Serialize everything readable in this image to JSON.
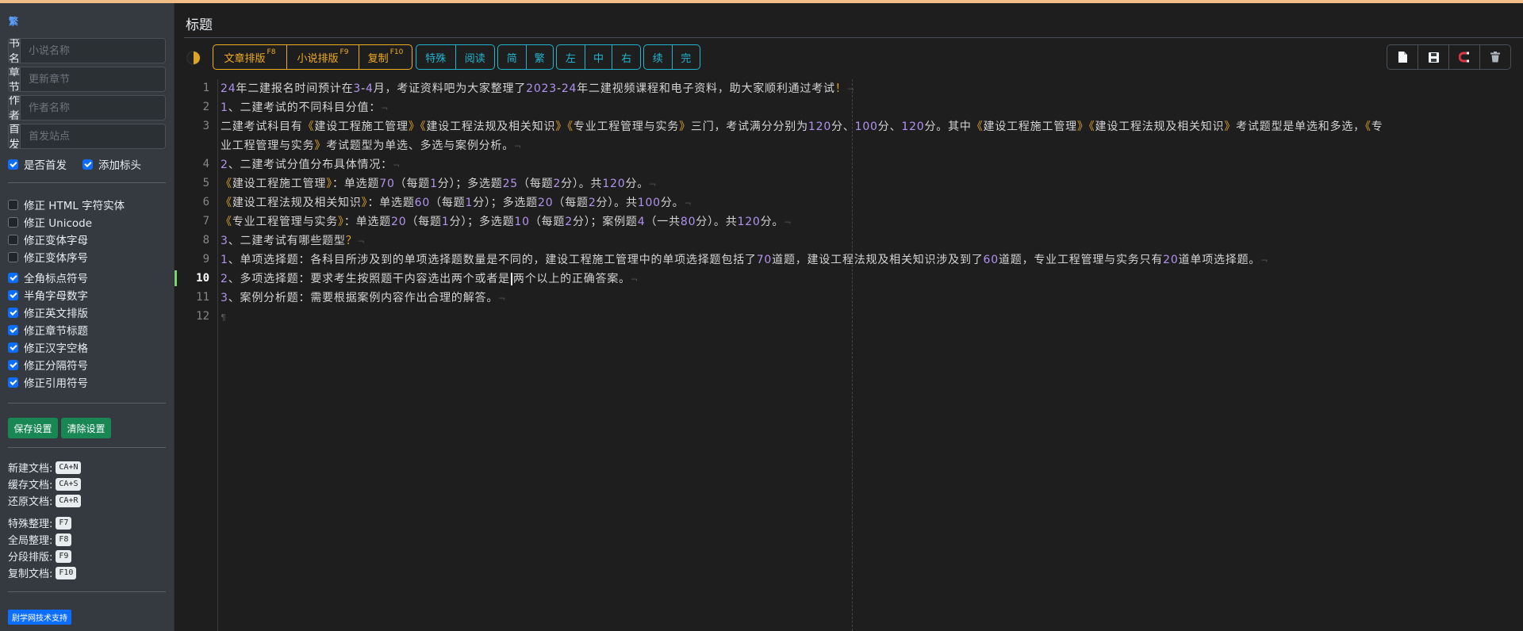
{
  "sidebar": {
    "logo": "繁",
    "fields": [
      {
        "label": "书名",
        "placeholder": "小说名称"
      },
      {
        "label": "章节",
        "placeholder": "更新章节"
      },
      {
        "label": "作者",
        "placeholder": "作者名称"
      },
      {
        "label": "首发",
        "placeholder": "首发站点"
      }
    ],
    "is_first": {
      "label": "是否首发",
      "checked": true
    },
    "add_header": {
      "label": "添加标头",
      "checked": true
    },
    "fix_options": [
      {
        "label": "修正 HTML 字符实体",
        "checked": false
      },
      {
        "label": "修正 Unicode",
        "checked": false
      },
      {
        "label": "修正变体字母",
        "checked": false
      },
      {
        "label": "修正变体序号",
        "checked": false
      },
      {
        "label": "全角标点符号",
        "checked": true
      },
      {
        "label": "半角字母数字",
        "checked": true
      },
      {
        "label": "修正英文排版",
        "checked": true
      },
      {
        "label": "修正章节标题",
        "checked": true
      },
      {
        "label": "修正汉字空格",
        "checked": true
      },
      {
        "label": "修正分隔符号",
        "checked": true
      },
      {
        "label": "修正引用符号",
        "checked": true
      }
    ],
    "save_label": "保存设置",
    "clear_label": "清除设置",
    "shortcuts_doc": [
      {
        "label": "新建文档:",
        "key": "CA+N"
      },
      {
        "label": "缓存文档:",
        "key": "CA+S"
      },
      {
        "label": "还原文档:",
        "key": "CA+R"
      }
    ],
    "shortcuts_fmt": [
      {
        "label": "特殊整理:",
        "key": "F7"
      },
      {
        "label": "全局整理:",
        "key": "F8"
      },
      {
        "label": "分段排版:",
        "key": "F9"
      },
      {
        "label": "复制文档:",
        "key": "F10"
      }
    ],
    "support": "尉学网技术支持"
  },
  "main": {
    "title": "标题",
    "toolbar": {
      "article_layout": "文章排版",
      "article_key": "F8",
      "novel_layout": "小说排版",
      "novel_key": "F9",
      "copy": "复制",
      "copy_key": "F10",
      "special": "特殊",
      "read": "阅读",
      "simplified": "简",
      "traditional": "繁",
      "left": "左",
      "center": "中",
      "right": "右",
      "continue": "续",
      "finish": "完"
    },
    "icons": [
      "new-file-icon",
      "save-icon",
      "magnet-icon",
      "trash-icon"
    ],
    "colors": {
      "accent_amber": "#f0ad1e",
      "accent_teal": "#1fb5cf",
      "number": "#b392f0",
      "quote": "#e0a526",
      "current_line": "#7fd36b"
    }
  },
  "editor": {
    "active_line": 10,
    "line_numbers": [
      "1",
      "2",
      "3",
      "4",
      "5",
      "6",
      "7",
      "8",
      "9",
      "10",
      "11",
      "12"
    ],
    "lines": [
      "24年二建报名时间预计在3-4月，考证资料吧为大家整理了2023-24年二建视频课程和电子资料，助大家顺利通过考试！",
      "1、二建考试的不同科目分值：",
      "二建考试科目有《建设工程施工管理》《建设工程法规及相关知识》《专业工程管理与实务》三门，考试满分分别为120分、100分、120分。其中《建设工程施工管理》《建设工程法规及相关知识》考试题型是单选和多选，《专",
      "业工程管理与实务》考试题型为单选、多选与案例分析。",
      "2、二建考试分值分布具体情况：",
      "《建设工程施工管理》：单选题70（每题1分）；多选题25（每题2分）。共120分。",
      "《建设工程法规及相关知识》：单选题60（每题1分）；多选题20（每题2分）。共100分。",
      "《专业工程管理与实务》：单选题20（每题1分）；多选题10（每题2分）；案例题4（一共80分）。共120分。",
      "3、二建考试有哪些题型？",
      "1、单项选择题：各科目所涉及到的单项选择题数量是不同的，建设工程施工管理中的单项选择题包括了70道题，建设工程法规及相关知识涉及到了60道题，专业工程管理与实务只有20道单项选择题。",
      "2、多项选择题：要求考生按照题干内容选出两个或者是两个以上的正确答案。",
      "3、案例分析题：需要根据案例内容作出合理的解答。",
      ""
    ]
  }
}
